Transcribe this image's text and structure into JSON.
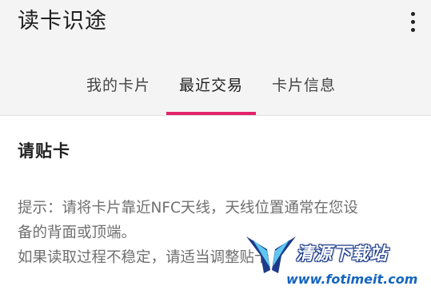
{
  "app_bar": {
    "title": "读卡识途",
    "overflow_icon": "more-vert-icon"
  },
  "tabs": [
    {
      "label": "我的卡片",
      "active": false
    },
    {
      "label": "最近交易",
      "active": true
    },
    {
      "label": "卡片信息",
      "active": false
    }
  ],
  "colors": {
    "accent": "#e2226a",
    "app_bar_bg": "#f4f4f4"
  },
  "content": {
    "status": "请贴卡",
    "hint_lines": [
      "提示：请将卡片靠近NFC天线，天线位置通常在您设",
      "备的背面或顶端。",
      "如果读取过程不稳定，请适当调整贴卡"
    ]
  },
  "watermark": {
    "logo_icon": "wing-logo-icon",
    "text": "清源下载站",
    "url": "www.fotimeit.com"
  }
}
